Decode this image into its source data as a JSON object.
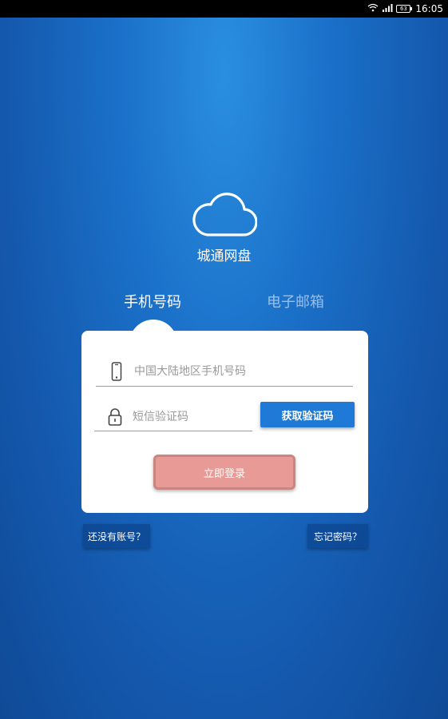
{
  "status_bar": {
    "battery": "63",
    "time": "16:05",
    "icons": [
      "wifi-icon",
      "signal-icon",
      "battery-icon"
    ]
  },
  "app": {
    "logo_icon": "cloud-icon",
    "name": "城通网盘"
  },
  "tabs": [
    {
      "label": "手机号码",
      "active": true
    },
    {
      "label": "电子邮箱",
      "active": false
    }
  ],
  "form": {
    "phone": {
      "icon": "smartphone-icon",
      "placeholder": "中国大陆地区手机号码",
      "value": ""
    },
    "code": {
      "icon": "lock-icon",
      "placeholder": "短信验证码",
      "value": ""
    },
    "get_code_label": "获取验证码",
    "login_label": "立即登录"
  },
  "links": {
    "register": "还没有账号？",
    "forgot": "忘记密码？"
  },
  "colors": {
    "background": "#1a6fc7",
    "get_code_button": "#1e7ad6",
    "login_button": "#e89b96"
  }
}
